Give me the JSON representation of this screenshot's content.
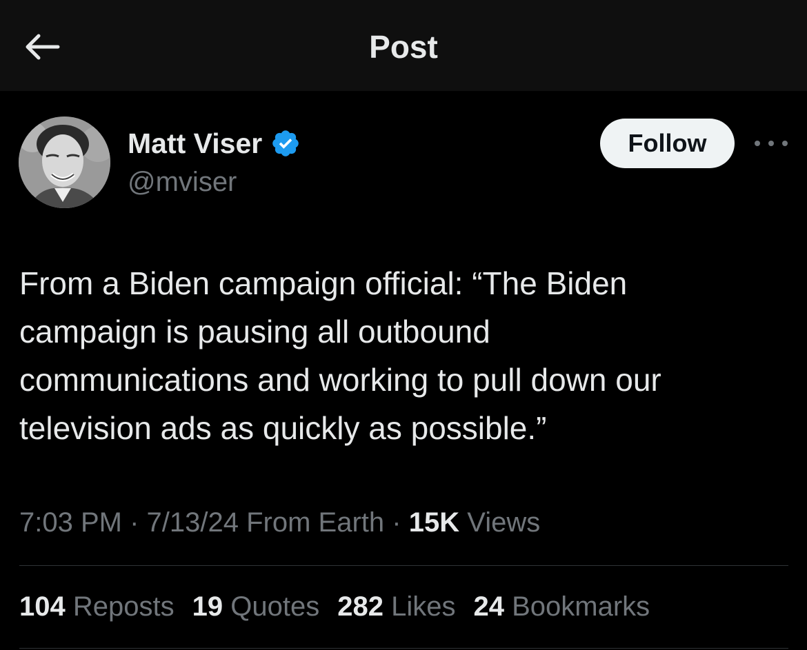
{
  "header": {
    "title": "Post",
    "back_icon": "arrow-left-icon"
  },
  "author": {
    "display_name": "Matt Viser",
    "handle": "@mviser",
    "verified_icon": "verified-badge-icon",
    "verified_color": "#1d9bf0"
  },
  "actions": {
    "follow_label": "Follow",
    "more_icon": "more-horizontal-icon"
  },
  "tweet": {
    "text": "From a Biden campaign official: “The Biden\ncampaign is pausing all outbound\ncommunications and working to pull down our\ntelevision ads as quickly as possible.”"
  },
  "meta": {
    "time": "7:03 PM",
    "date": "7/13/24",
    "source": "From Earth",
    "views_count": "15K",
    "views_label": "Views"
  },
  "stats": [
    {
      "count": "104",
      "label": "Reposts"
    },
    {
      "count": "19",
      "label": "Quotes"
    },
    {
      "count": "282",
      "label": "Likes"
    },
    {
      "count": "24",
      "label": "Bookmarks"
    }
  ],
  "colors": {
    "background": "#000000",
    "topbar": "#0f0f0f",
    "text_primary": "#e7e9ea",
    "text_secondary": "#71767b",
    "follow_bg": "#eff3f4",
    "divider": "#2f3336"
  }
}
